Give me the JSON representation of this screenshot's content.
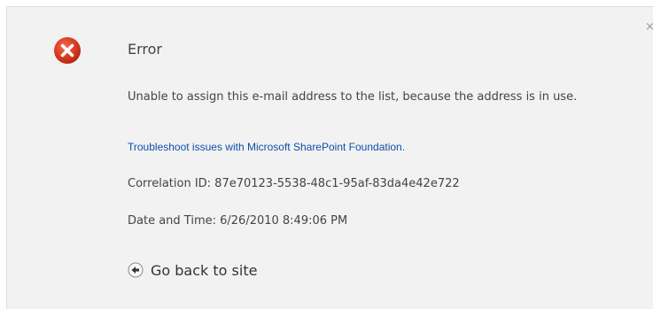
{
  "dialog": {
    "close_label": "×",
    "title": "Error",
    "message": "Unable to assign this e-mail address to the list, because the address is in use.",
    "troubleshoot_link": "Troubleshoot issues with Microsoft SharePoint Foundation.",
    "correlation": "Correlation ID: 87e70123-5538-48c1-95af-83da4e42e722",
    "datetime": "Date and Time: 6/26/2010 8:49:06 PM",
    "go_back_label": "Go back to site",
    "icons": {
      "error": "error-icon",
      "back": "back-arrow-icon",
      "close": "close-icon"
    },
    "colors": {
      "error_red": "#d83a22",
      "link_blue": "#0f4fa8",
      "background": "#f2f2f2"
    }
  }
}
